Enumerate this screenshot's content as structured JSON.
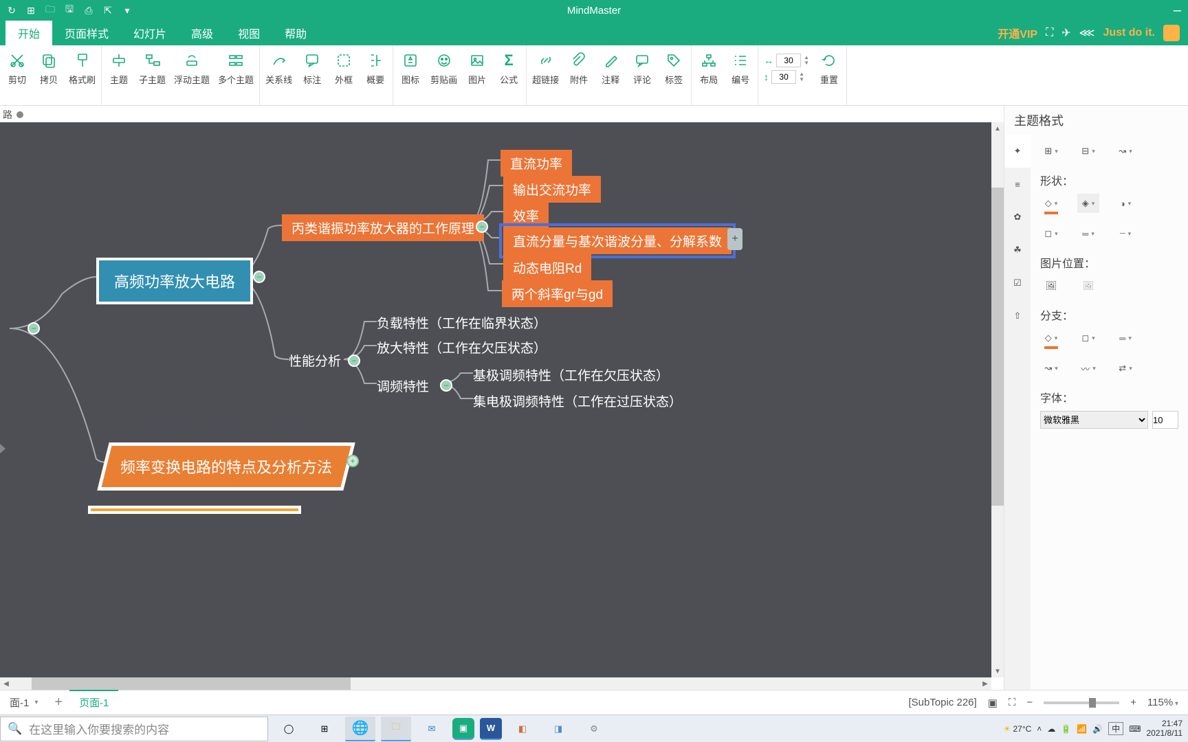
{
  "app": {
    "title": "MindMaster"
  },
  "qat": [
    "undo",
    "new",
    "open",
    "save",
    "print",
    "export",
    "more"
  ],
  "menu": {
    "items": [
      "开始",
      "页面样式",
      "幻灯片",
      "高级",
      "视图",
      "帮助"
    ],
    "active": 0,
    "vip": "开通VIP",
    "user": "Just do it."
  },
  "ribbon": {
    "cut": "剪切",
    "copy": "拷贝",
    "format": "格式刷",
    "topic": "主题",
    "subtopic": "子主题",
    "float": "浮动主题",
    "multi": "多个主题",
    "relation": "关系线",
    "callout": "标注",
    "boundary": "外框",
    "summary": "概要",
    "icon": "图标",
    "clipart": "剪贴画",
    "image": "图片",
    "formula": "公式",
    "hyperlink": "超链接",
    "attach": "附件",
    "note": "注释",
    "comment": "评论",
    "tag": "标签",
    "layout": "布局",
    "number": "编号",
    "hspace": "30",
    "vspace": "30",
    "reset": "重置"
  },
  "doc_tab": "路",
  "mindmap": {
    "main": "高频功率放大电路",
    "branch1_orange_root": "丙类谐振功率放大器的工作原理",
    "b1": [
      "直流功率",
      "输出交流功率",
      "效率",
      "直流分量与基次谐波分量、分解系数",
      "动态电阻Rd",
      "两个斜率gr与gd"
    ],
    "perf": "性能分析",
    "perf_items": [
      "负载特性（工作在临界状态）",
      "放大特性（工作在欠压状态）"
    ],
    "mod": "调频特性",
    "mod_items": [
      "基极调频特性（工作在欠压状态）",
      "集电极调频特性（工作在过压状态）"
    ],
    "branch2": "频率变换电路的特点及分析方法"
  },
  "side": {
    "title": "主题格式",
    "shape_label": "形状：",
    "img_label": "图片位置：",
    "branch_label": "分支：",
    "font_label": "字体：",
    "font_name": "微软雅黑",
    "font_size": "10"
  },
  "page_tabs": {
    "a": "面-1",
    "b": "页面-1"
  },
  "status": {
    "subtopic": "[SubTopic 226]",
    "zoom": "115%"
  },
  "taskbar": {
    "search_ph": "在这里输入你要搜索的内容",
    "weather": "27°C",
    "ime": "中",
    "time": "21:47",
    "date": "2021/8/11"
  }
}
